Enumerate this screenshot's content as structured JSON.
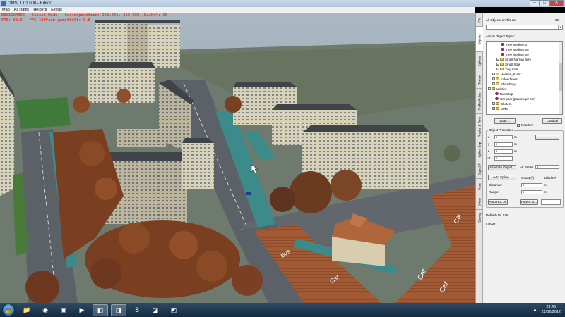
{
  "window": {
    "title": "OMSI 1.01.000 - Editor",
    "minimize_label": "–",
    "maximize_label": "□",
    "close_label": "✕"
  },
  "menu": {
    "items": [
      "Map",
      "AI Traffic",
      "Helpers",
      "Extras"
    ]
  },
  "viewport": {
    "debug_line1": "DESIGNMODE - Select Mode - Cursorposition: 269.091, 218.208, Kachel: 65",
    "debug_line2": "FPS: 63.6 - FPS 100Fach gemittelt: 9.8",
    "road_markings": [
      "Car",
      "Car",
      "Car",
      "Car",
      "Bus"
    ]
  },
  "panel": {
    "tabs": [
      "File",
      "Objects",
      "Splines",
      "Terrain",
      "Traffic Rules",
      "Tracks & Time",
      "Spline-Exp.",
      "Signal/Tt",
      "Pass",
      "Driver",
      "Debug"
    ],
    "active_tab": "Objects",
    "all_objects_label": "All Objects on Tile Nr.",
    "all_objects_count": "65",
    "actual_types_label": "Actual Object Types:",
    "tree": [
      {
        "label": "Tree Medium 07",
        "type": "obj",
        "indent": 4
      },
      {
        "label": "Tree Medium 08",
        "type": "obj",
        "indent": 4
      },
      {
        "label": "Tree Medium 09",
        "type": "obj",
        "indent": 4
      },
      {
        "label": "Small Narrow Size",
        "type": "folder",
        "indent": 3
      },
      {
        "label": "Small Size",
        "type": "folder",
        "indent": 3
      },
      {
        "label": "Tiny Size",
        "type": "folder",
        "indent": 3
      },
      {
        "label": "Hecken_Kranz",
        "type": "folder",
        "indent": 2
      },
      {
        "label": "Indeedtrees",
        "type": "folder",
        "indent": 2
      },
      {
        "label": "Shrubbery",
        "type": "folder",
        "indent": 2
      },
      {
        "label": "Utilities",
        "type": "folder",
        "indent": 1
      },
      {
        "label": "Bus Stop",
        "type": "obj",
        "indent": 2
      },
      {
        "label": "Car park (passenger car)",
        "type": "obj",
        "indent": 2
      },
      {
        "label": "Clutters",
        "type": "folder",
        "indent": 2
      },
      {
        "label": "Deko",
        "type": "folder",
        "indent": 2
      }
    ],
    "load_label": "Load ...",
    "load_all_label": "Load all",
    "random_label": "Random",
    "object_props_label": "Object Properties",
    "field_x_label": "x",
    "field_y_label": "y",
    "field_z_label": "z",
    "field_rot_label": "rot",
    "field_x": "0",
    "field_y": "0",
    "field_z": "0",
    "field_rot": "0",
    "unit_m": "m",
    "attach_label": "Attach to Object...",
    "att_prefix_label": "Att.PrefN:",
    "att_prefix_value": "0",
    "to_spline_label": "-> to Spline...",
    "count_label": "Count (°)",
    "label_label": "Label8.7",
    "distance_label": "Distance:",
    "distance_value": "0",
    "range_label": "Range:",
    "range_value": "0",
    "auto_rot_label": "Auto Rot. All",
    "parent_to_label": "Parent to...",
    "refresh_label": "Refresh Nr.",
    "refresh_value": "578",
    "label4": "Label4"
  },
  "taskbar": {
    "time": "23:46",
    "date": "22/02/2012",
    "tray_arrow": "▲",
    "apps": [
      {
        "name": "explorer-icon",
        "glyph": "📁",
        "active": false
      },
      {
        "name": "firefox-icon",
        "glyph": "◉",
        "active": false
      },
      {
        "name": "device-icon",
        "glyph": "▣",
        "active": false
      },
      {
        "name": "media-player-icon",
        "glyph": "▶",
        "active": false
      },
      {
        "name": "omsi-app-icon",
        "glyph": "◧",
        "active": true
      },
      {
        "name": "omsi-window-icon",
        "glyph": "◨",
        "active": true
      },
      {
        "name": "skype-icon",
        "glyph": "S",
        "active": false
      },
      {
        "name": "gallery-icon",
        "glyph": "◪",
        "active": false
      },
      {
        "name": "paint-icon",
        "glyph": "◩",
        "active": false
      }
    ]
  },
  "colors": {
    "debug_text": "#e23a2a",
    "road": "#5c6168",
    "building_wall": "#d8d2b6",
    "roof": "#3f4448",
    "tree_autumn": "#8b4a26",
    "road_marking": "#ffffff"
  }
}
